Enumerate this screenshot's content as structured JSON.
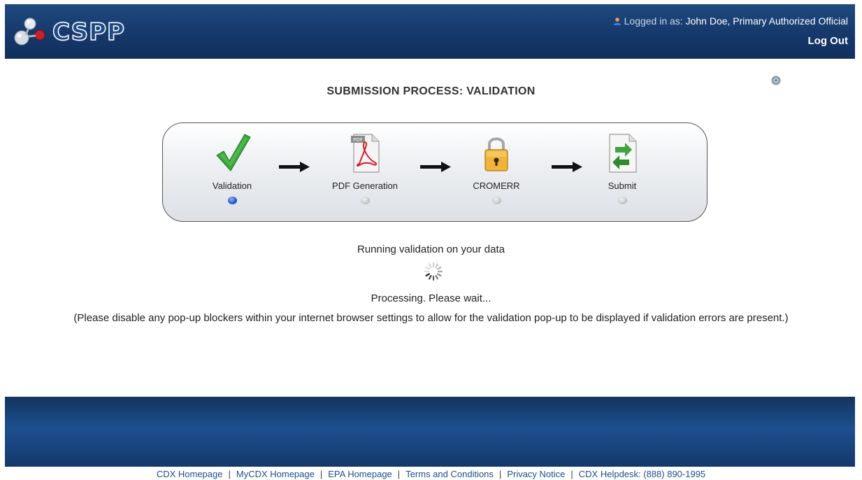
{
  "header": {
    "logo_text": "CSPP",
    "logged_in_label": "Logged in as:",
    "user_name": "John Doe, Primary Authorized Official",
    "logout_label": "Log Out"
  },
  "page_title": "SUBMISSION PROCESS: VALIDATION",
  "steps": [
    {
      "label": "Validation",
      "icon": "checkmark-icon",
      "active": true
    },
    {
      "label": "PDF Generation",
      "icon": "pdf-icon",
      "active": false
    },
    {
      "label": "CROMERR",
      "icon": "lock-icon",
      "active": false
    },
    {
      "label": "Submit",
      "icon": "submit-document-icon",
      "active": false
    }
  ],
  "status": {
    "running": "Running validation on your data",
    "processing": "Processing. Please wait...",
    "popup_note": "(Please disable any pop-up blockers within your internet browser settings to allow for the validation pop-up to be displayed if validation errors are present.)"
  },
  "footer": {
    "links": [
      "CDX Homepage",
      "MyCDX Homepage",
      "EPA Homepage",
      "Terms and Conditions",
      "Privacy Notice",
      "CDX Helpdesk: (888) 890-1995"
    ]
  },
  "colors": {
    "header_bg": "#16386a",
    "active_dot": "#2a5bd0",
    "check_green": "#3aa53a",
    "link": "#1f4f8c"
  }
}
